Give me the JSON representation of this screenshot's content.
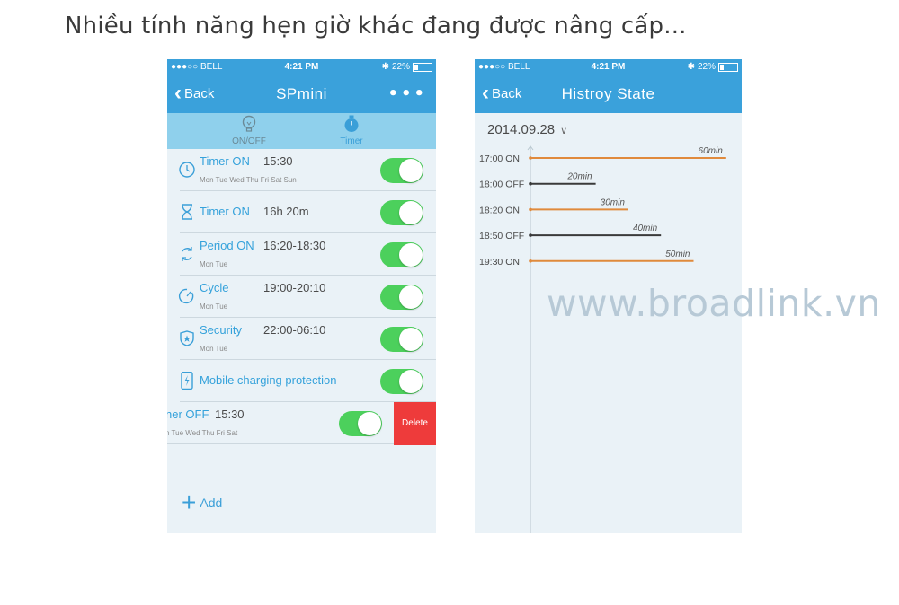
{
  "heading": "Nhiều tính năng hẹn giờ khác đang được nâng cấp...",
  "watermark": "www.broadlink.vn",
  "phone1": {
    "status": {
      "carrier": "●●●○○ BELL",
      "time": "4:21 PM",
      "battery": "22%"
    },
    "nav": {
      "back": "Back",
      "title": "SPmini",
      "more": "•••"
    },
    "modes": [
      {
        "label": "ON/OFF",
        "icon": "bulb-icon"
      },
      {
        "label": "Timer",
        "icon": "stopwatch-icon"
      }
    ],
    "rows": [
      {
        "icon": "clock-icon",
        "name": "Timer ON",
        "value": "15:30",
        "days": "Mon Tue Wed Thu Fri Sat Sun",
        "toggle": true
      },
      {
        "icon": "hourglass-icon",
        "name": "Timer  ON",
        "value": "16h 20m",
        "days": "",
        "toggle": true
      },
      {
        "icon": "repeat-icon",
        "name": "Period ON",
        "value": "16:20-18:30",
        "days": "Mon Tue",
        "toggle": true
      },
      {
        "icon": "cycle-icon",
        "name": "Cycle",
        "value": "19:00-20:10",
        "days": "Mon Tue",
        "toggle": true
      },
      {
        "icon": "shield-icon",
        "name": "Security",
        "value": "22:00-06:10",
        "days": "Mon Tue",
        "toggle": true
      },
      {
        "icon": "phone-charging-icon",
        "name": "Mobile charging protection",
        "value": "",
        "days": "",
        "toggle": true
      }
    ],
    "swiped_row": {
      "name": "ner OFF",
      "value": "15:30",
      "days": "n Tue Wed Thu Fri Sat",
      "toggle": true,
      "delete_label": "Delete"
    },
    "add_label": "Add"
  },
  "phone2": {
    "status": {
      "carrier": "●●●○○ BELL",
      "time": "4:21 PM",
      "battery": "22%"
    },
    "nav": {
      "back": "Back",
      "title": "Histroy State"
    },
    "date": "2014.09.28",
    "colors": {
      "on": "#e08a3c",
      "off": "#3a3a3a"
    },
    "chart_data": {
      "type": "bar",
      "categories": [
        "17:00 ON",
        "18:00 OFF",
        "18:20 ON",
        "18:50 OFF",
        "19:30 ON"
      ],
      "values": [
        60,
        20,
        30,
        40,
        50
      ],
      "value_labels": [
        "60min",
        "20min",
        "30min",
        "40min",
        "50min"
      ],
      "states": [
        "on",
        "off",
        "on",
        "off",
        "on"
      ],
      "orientation": "horizontal",
      "grid": false
    }
  }
}
